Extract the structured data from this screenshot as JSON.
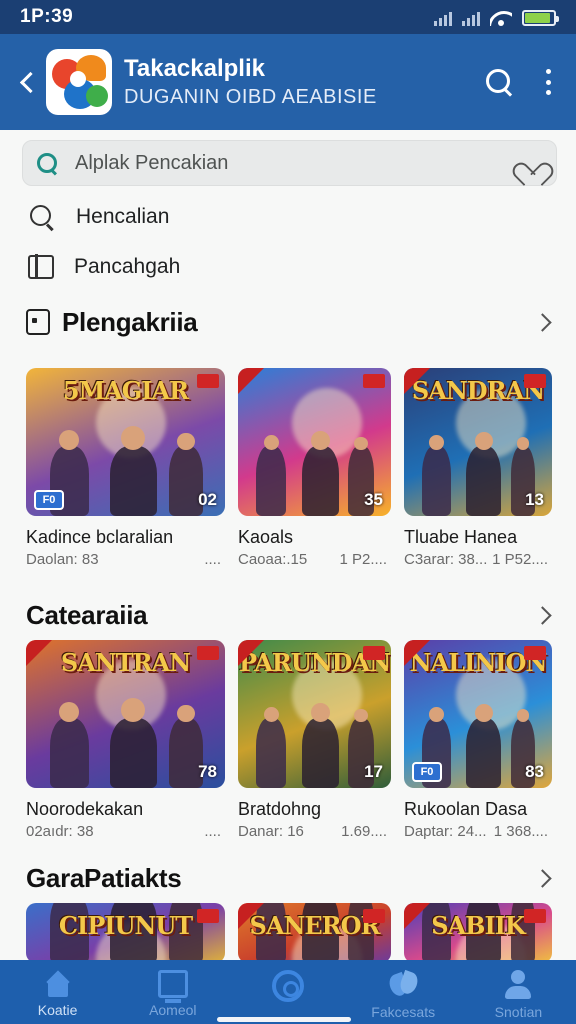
{
  "status": {
    "time": "1P:39"
  },
  "header": {
    "app_title": "Takackalplik",
    "app_subtitle": "DUGANIN OIBD AEABISIE",
    "icons": {
      "back": "back-arrow-icon",
      "logo": "app-logo",
      "search": "search-icon",
      "more": "more-vertical-icon"
    }
  },
  "search": {
    "placeholder": "Alplak Pencakian"
  },
  "menu": [
    {
      "label": "Hencalian",
      "icon": "search-icon"
    },
    {
      "label": "Pancahgah",
      "icon": "book-icon"
    }
  ],
  "sections": [
    {
      "title": "Plengakriia",
      "icon": "folder-icon",
      "cards": [
        {
          "name": "Kadince bclaralian",
          "meta_left": "Daolan: 83",
          "meta_right": "....",
          "count": "02",
          "chip": "F0",
          "art_title": "5MAGIAR",
          "palette": [
            "#f2b53a",
            "#7c4aa8",
            "#3a6fb5"
          ]
        },
        {
          "name": "Kaoals",
          "meta_left": "Caoaa:.15",
          "meta_right": "1 P2....",
          "count": "35",
          "chip": "",
          "art_title": "",
          "palette": [
            "#2b7fd8",
            "#d23a8c",
            "#f7b229"
          ]
        },
        {
          "name": "Tluabe Hanea",
          "meta_left": "C3arar: 38...",
          "meta_right": "1 P52....",
          "count": "13",
          "chip": "",
          "art_title": "SANDRAN",
          "palette": [
            "#2b3f78",
            "#1f6fb5",
            "#d9a63a"
          ]
        }
      ]
    },
    {
      "title": "Catearaiia",
      "cards": [
        {
          "name": "Noorodekakan",
          "meta_left": "02aıdr: 38",
          "meta_right": "....",
          "count": "78",
          "chip": "",
          "art_title": "SANTRAN",
          "palette": [
            "#e0742a",
            "#6a3b9e",
            "#2a4f9e"
          ]
        },
        {
          "name": "Bratdohng",
          "meta_left": "Danar: 16",
          "meta_right": "1.69....",
          "count": "17",
          "chip": "",
          "art_title": "PARUNDAN",
          "palette": [
            "#3f8a4a",
            "#caa02c",
            "#2f5d3a"
          ]
        },
        {
          "name": "Rukoolan Dasa",
          "meta_left": "Daptar: 24...",
          "meta_right": "1 368....",
          "count": "83",
          "chip": "F0",
          "art_title": "NALINION",
          "palette": [
            "#5b3fa8",
            "#2b8fd8",
            "#e0a63a"
          ]
        }
      ]
    },
    {
      "title": "GaraPatiakts",
      "cards": [
        {
          "name": "",
          "meta_left": "",
          "meta_right": "",
          "count": "",
          "chip": "",
          "art_title": "CIPIUNUT",
          "palette": [
            "#3a6fc9",
            "#7a3fa8",
            "#e0b33a"
          ]
        },
        {
          "name": "",
          "meta_left": "",
          "meta_right": "",
          "count": "",
          "chip": "",
          "art_title": "SANEROR",
          "palette": [
            "#e07b2a",
            "#c9402c",
            "#6a3b9e"
          ]
        },
        {
          "name": "",
          "meta_left": "",
          "meta_right": "",
          "count": "",
          "chip": "",
          "art_title": "SABIIK",
          "palette": [
            "#4a3fb8",
            "#d84a8c",
            "#f0c040"
          ]
        }
      ]
    }
  ],
  "bottom_nav": [
    {
      "label": "Koatie",
      "icon": "home-icon",
      "active": true
    },
    {
      "label": "Aomeol",
      "icon": "tablet-icon",
      "active": false
    },
    {
      "label": "",
      "icon": "circle-icon",
      "active": false
    },
    {
      "label": "Fakcesats",
      "icon": "leaf-icon",
      "active": false
    },
    {
      "label": "Snotian",
      "icon": "user-icon",
      "active": false
    }
  ]
}
